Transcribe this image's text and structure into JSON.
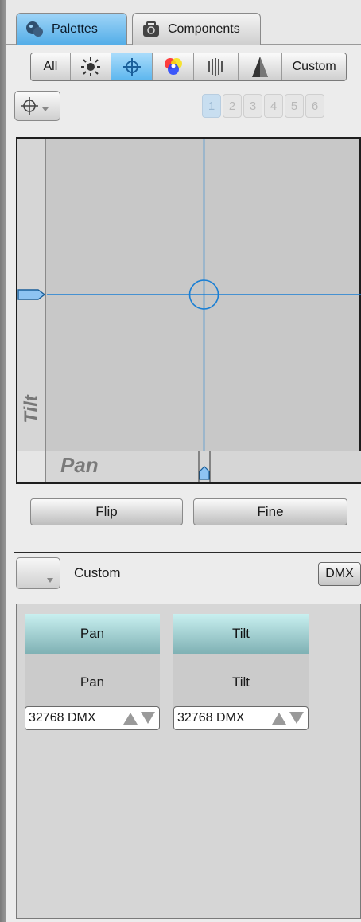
{
  "tabs": [
    {
      "label": "Palettes",
      "icon": "palettes-icon"
    },
    {
      "label": "Components",
      "icon": "components-icon"
    }
  ],
  "filters": {
    "all_label": "All",
    "custom_label": "Custom",
    "icons": [
      "intensity-icon",
      "position-icon",
      "color-icon",
      "beam-icon",
      "shape-icon"
    ]
  },
  "pages": [
    "1",
    "2",
    "3",
    "4",
    "5",
    "6"
  ],
  "xy_pad": {
    "tilt_label": "Tilt",
    "pan_label": "Pan",
    "pan_fraction": 0.5,
    "tilt_fraction": 0.5,
    "crosshair_color": "#1a7fd4"
  },
  "buttons": {
    "flip": "Flip",
    "fine": "Fine"
  },
  "custom": {
    "label": "Custom",
    "dmx": "DMX"
  },
  "channels": [
    {
      "header": "Pan",
      "name": "Pan",
      "value": "32768 DMX"
    },
    {
      "header": "Tilt",
      "name": "Tilt",
      "value": "32768 DMX"
    }
  ],
  "colors": {
    "accent": "#54aee8",
    "header_teal": "#7fb1b4"
  }
}
